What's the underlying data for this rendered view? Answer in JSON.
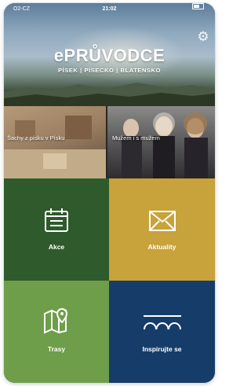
{
  "status_bar": {
    "carrier": "O2-CZ",
    "time": "21:02"
  },
  "header": {
    "logo": "ePRŮVODCE",
    "tagline": "PÍSEK | PÍSECKO | BLATENSKO",
    "settings_icon": "gear-icon"
  },
  "carousel": {
    "items": [
      {
        "label": "Šachy z písku v Písku"
      },
      {
        "label": "Mužem i s mužem"
      }
    ]
  },
  "tiles": [
    {
      "label": "Akce",
      "icon": "calendar-icon",
      "color": "#2f5a2c"
    },
    {
      "label": "Aktuality",
      "icon": "envelope-icon",
      "color": "#c8a23a"
    },
    {
      "label": "Trasy",
      "icon": "map-pin-icon",
      "color": "#6e9e4a"
    },
    {
      "label": "Inspirujte se",
      "icon": "bridge-icon",
      "color": "#163d6a"
    }
  ]
}
